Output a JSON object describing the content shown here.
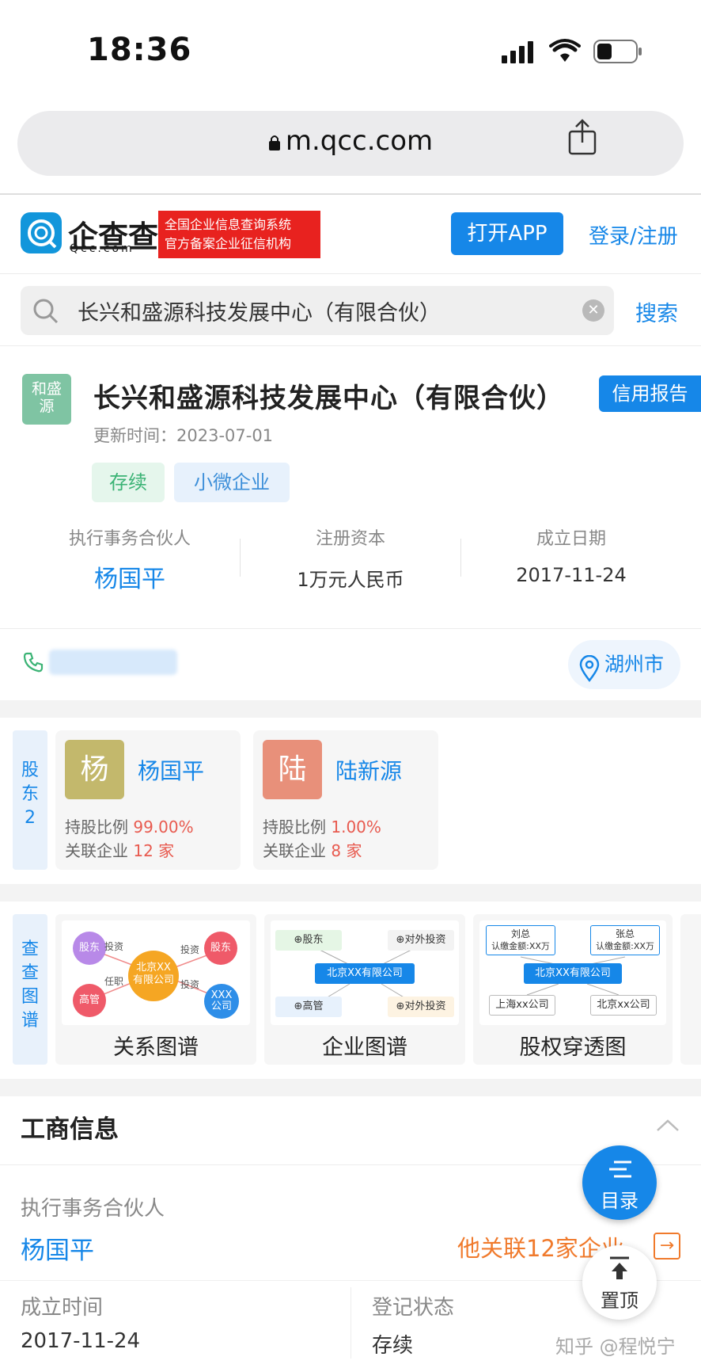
{
  "status_bar": {
    "time": "18:36"
  },
  "browser": {
    "url": "m.qcc.com"
  },
  "header": {
    "logo_text": "企查查",
    "logo_sub": "Qcc.com",
    "slogan_line1": "全国企业信息查询系统",
    "slogan_line2": "官方备案企业征信机构",
    "open_app": "打开APP",
    "login": "登录/注册"
  },
  "search": {
    "query": "长兴和盛源科技发展中心（有限合伙）",
    "button": "搜索"
  },
  "company": {
    "logo_text": "和盛源",
    "name": "长兴和盛源科技发展中心（有限合伙）",
    "credit_report": "信用报告",
    "updated": "更新时间：2023-07-01",
    "tags": [
      "存续",
      "小微企业"
    ],
    "stats": [
      {
        "label": "执行事务合伙人",
        "value": "杨国平"
      },
      {
        "label": "注册资本",
        "value": "1万元人民币"
      },
      {
        "label": "成立日期",
        "value": "2017-11-24"
      }
    ],
    "city": "湖州市"
  },
  "shareholders": {
    "tab": "股东",
    "count": "2",
    "items": [
      {
        "avatar": "杨",
        "name": "杨国平",
        "ratio_label": "持股比例",
        "ratio": "99.00%",
        "related_label": "关联企业",
        "related": "12 家",
        "color": "#c3b86c"
      },
      {
        "avatar": "陆",
        "name": "陆新源",
        "ratio_label": "持股比例",
        "ratio": "1.00%",
        "related_label": "关联企业",
        "related": "8 家",
        "color": "#e8907a"
      }
    ]
  },
  "graphs": {
    "tab": "查查图谱",
    "items": [
      {
        "label": "关系图谱"
      },
      {
        "label": "企业图谱"
      },
      {
        "label": "股权穿透图"
      }
    ],
    "rel": {
      "n1": "股东",
      "n2": "股东",
      "n3": "高管",
      "center": "北京XX有限公司",
      "n4": "XXX公司",
      "e1": "投资",
      "e2": "投资",
      "e3": "任职",
      "e4": "投资"
    },
    "ent": {
      "b1": "⊕股东",
      "b2": "⊕对外投资",
      "b3": "⊕高管",
      "b4": "⊕对外投资",
      "center": "北京XX有限公司"
    },
    "eq": {
      "p1": "刘总",
      "p1s": "认缴金额:XX万",
      "p2": "张总",
      "p2s": "认缴金额:XX万",
      "center": "北京XX有限公司",
      "c1": "上海xx公司",
      "c2": "北京xx公司"
    }
  },
  "business_info": {
    "title": "工商信息",
    "partner_label": "执行事务合伙人",
    "partner": "杨国平",
    "related": "他关联12家企业",
    "found_label": "成立时间",
    "found": "2017-11-24",
    "status_label": "登记状态",
    "status": "存续"
  },
  "fab": {
    "menu": "目录",
    "top": "置顶"
  },
  "watermark": "知乎 @程悦宁"
}
